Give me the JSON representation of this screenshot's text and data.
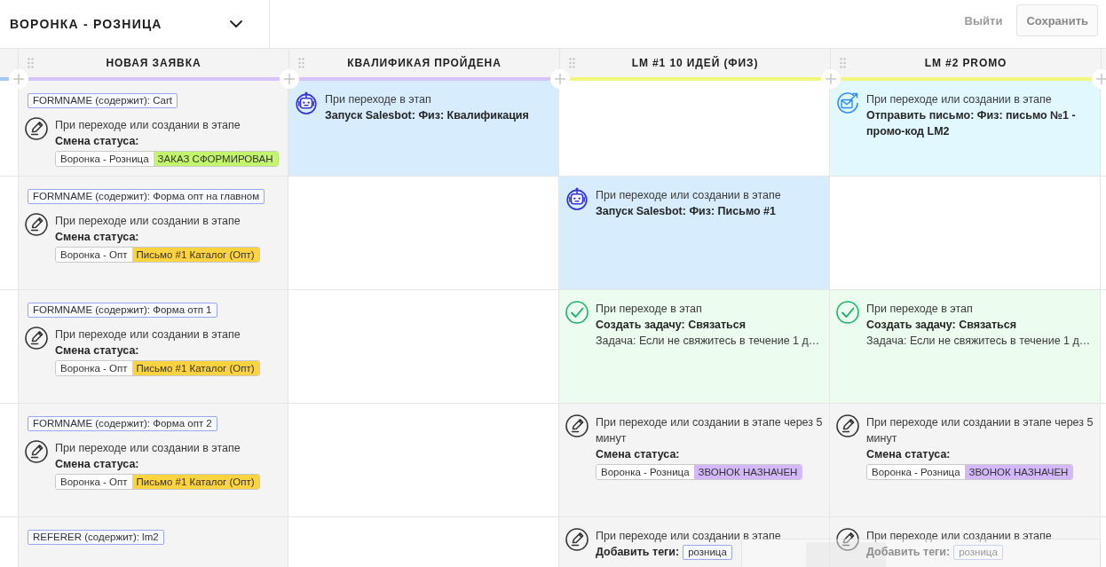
{
  "header": {
    "title": "ВОРОНКА - РОЗНИЦА",
    "buttons": [
      {
        "label": "Выйти",
        "kind": "text"
      },
      {
        "label": "Сохранить",
        "kind": "outlined"
      }
    ]
  },
  "columns": [
    {
      "title": "НОВАЯ ЗАЯВКА",
      "color": "#d5c3fa"
    },
    {
      "title": "КВАЛИФИКАЯ ПРОЙДЕНА",
      "color": "#d5c3fa"
    },
    {
      "title": "LM #1 10 ИДЕЙ (ФИЗ)",
      "color": "#f2f77c"
    },
    {
      "title": "LM #2 PROMO",
      "color": "#f2f77c"
    }
  ],
  "rows": [
    [
      {
        "kind": "status",
        "condition": "FORMNAME (содержит): Cart",
        "trigger": "При переходе или создании в этапе",
        "title": "Смена статуса:",
        "pipeline": "Воронка - Розница",
        "status": "ЗАКАЗ СФОРМИРОВАН",
        "color": "#c3f56c"
      },
      {
        "kind": "bot",
        "trigger": "При переходе в этап",
        "title": "Запуск Salesbot: Физ: Квалификация"
      },
      {
        "kind": "empty"
      },
      {
        "kind": "email",
        "trigger": "При переходе или создании в этапе",
        "title": "Отправить письмо: Физ: письмо №1 - промо-код LM2"
      }
    ],
    [
      {
        "kind": "status",
        "condition": "FORMNAME (содержит): Форма опт на главном",
        "trigger": "При переходе или создании в этапе",
        "title": "Смена статуса:",
        "pipeline": "Воронка - Опт",
        "status": "Письмо #1 Каталог (Опт)",
        "color": "#fdd33f"
      },
      {
        "kind": "empty"
      },
      {
        "kind": "bot",
        "trigger": "При переходе или создании в этапе",
        "title": "Запуск Salesbot: Физ: Письмо #1"
      },
      {
        "kind": "empty"
      }
    ],
    [
      {
        "kind": "status",
        "condition": "FORMNAME (содержит): Форма отп 1",
        "trigger": "При переходе или создании в этапе",
        "title": "Смена статуса:",
        "pipeline": "Воронка - Опт",
        "status": "Письмо #1 Каталог (Опт)",
        "color": "#fdd33f"
      },
      {
        "kind": "empty"
      },
      {
        "kind": "task",
        "trigger": "При переходе в этап",
        "title": "Создать задачу: Связаться",
        "detail": "Задача: Если не свяжитесь в течение 1 д…"
      },
      {
        "kind": "task",
        "trigger": "При переходе в этап",
        "title": "Создать задачу: Связаться",
        "detail": "Задача: Если не свяжитесь в течение 1 д…"
      }
    ],
    [
      {
        "kind": "status",
        "condition": "FORMNAME (содержит): Форма опт 2",
        "trigger": "При переходе или создании в этапе",
        "title": "Смена статуса:",
        "pipeline": "Воронка - Опт",
        "status": "Письмо #1 Каталог (Опт)",
        "color": "#fdd33f"
      },
      {
        "kind": "empty"
      },
      {
        "kind": "status",
        "trigger": "При переходе или создании в этапе через 5 минут",
        "title": "Смена статуса:",
        "pipeline": "Воронка - Розница",
        "status": "ЗВОНОК НАЗНАЧЕН",
        "color": "#d5b8fb"
      },
      {
        "kind": "status",
        "trigger": "При переходе или создании в этапе через 5 минут",
        "title": "Смена статуса:",
        "pipeline": "Воронка - Розница",
        "status": "ЗВОНОК НАЗНАЧЕН",
        "color": "#d5b8fb"
      }
    ],
    [
      {
        "kind": "status",
        "condition": "REFERER (содержит): lm2"
      },
      {
        "kind": "empty"
      },
      {
        "kind": "tags",
        "trigger": "При переходе или создании в этапе",
        "title": "Добавить теги:",
        "tags": [
          "розница"
        ]
      },
      {
        "kind": "tags",
        "trigger": "При переходе или создании в этапе",
        "title": "Добавить теги:",
        "tags": [
          "розница"
        ]
      }
    ]
  ]
}
